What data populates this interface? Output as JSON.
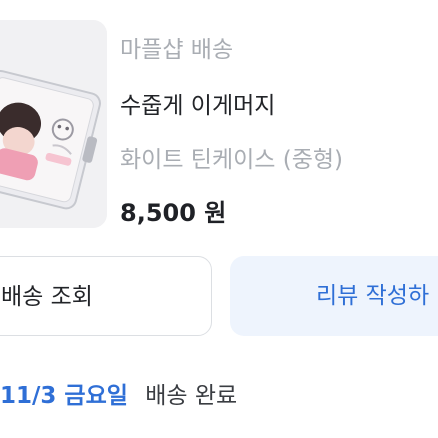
{
  "product": {
    "shop_label": "마플샵 배송",
    "name": "수줍게 이게머지",
    "option": "화이트 틴케이스 (중형)",
    "price": "8,500 원",
    "image_icon": "tin-case-product-photo"
  },
  "actions": {
    "track_label": "배송 조회",
    "review_label": "리뷰 작성하"
  },
  "delivery": {
    "date": "11/3 금요일",
    "status": "배송 완료"
  },
  "colors": {
    "accent": "#2f6fd6",
    "review_bg": "#eef4fd",
    "muted_text": "#a9adb3"
  }
}
